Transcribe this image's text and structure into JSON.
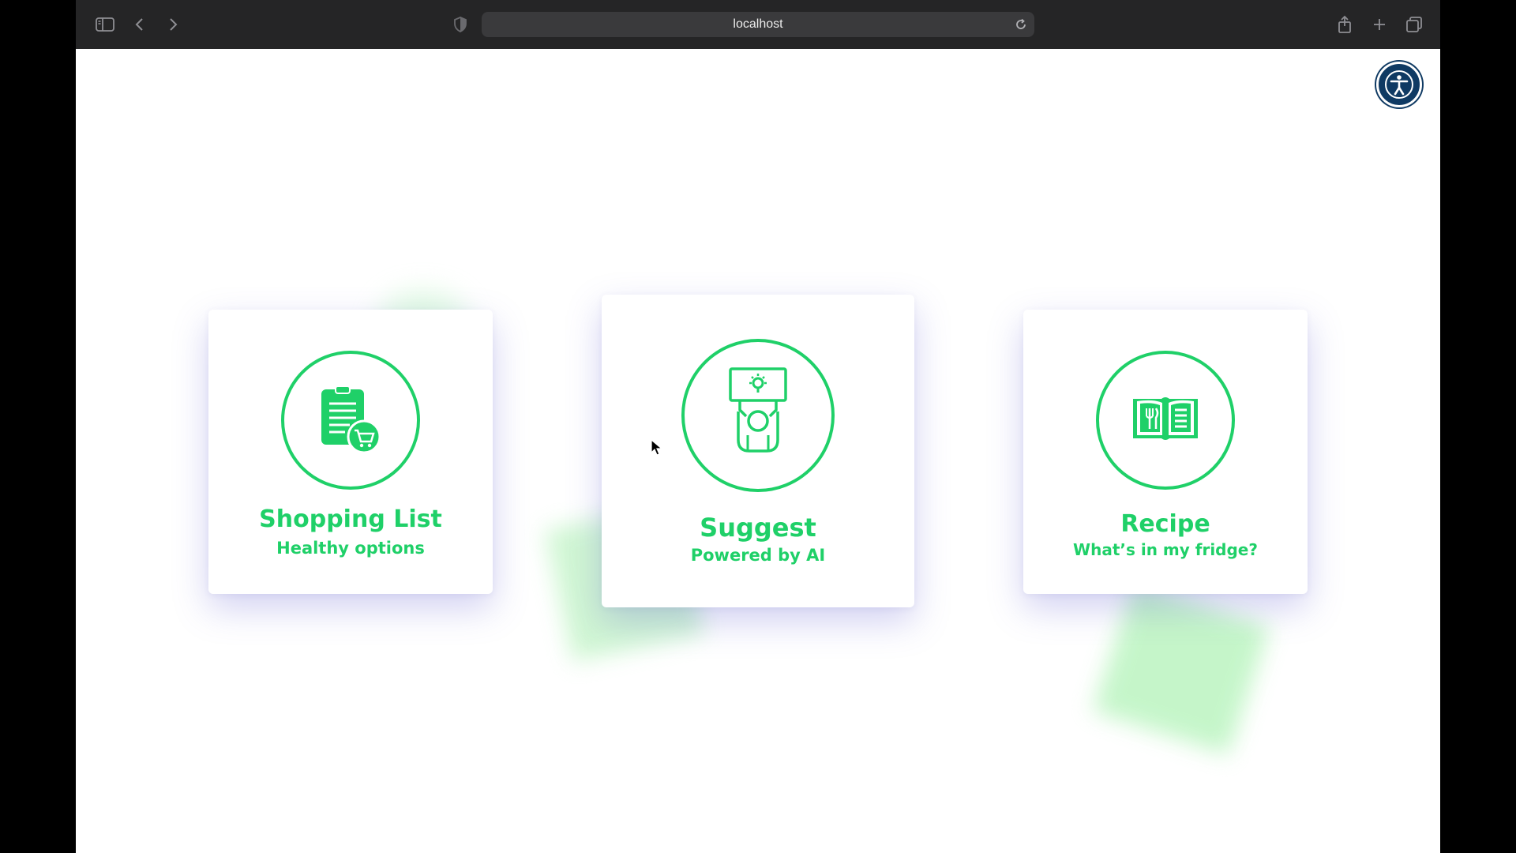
{
  "browser": {
    "url": "localhost",
    "icons": {
      "sidebar": "sidebar-icon",
      "back": "chevron-left-icon",
      "forward": "chevron-right-icon",
      "privacy": "shield-icon",
      "reload": "reload-icon",
      "share": "share-icon",
      "new_tab": "plus-icon",
      "tabs": "tabs-overview-icon"
    }
  },
  "accessibility": {
    "icon": "accessibility-icon"
  },
  "cards": [
    {
      "title": "Shopping List",
      "subtitle": "Healthy options",
      "icon": "shopping-list-cart-icon"
    },
    {
      "title": "Suggest",
      "subtitle": "Powered by AI",
      "icon": "idea-sign-person-icon"
    },
    {
      "title": "Recipe",
      "subtitle": "What’s in my fridge?",
      "icon": "recipe-book-icon"
    }
  ],
  "colors": {
    "accent": "#1fd068",
    "accessibility_button": "#0f3a63",
    "decor": "#bff5c4"
  }
}
